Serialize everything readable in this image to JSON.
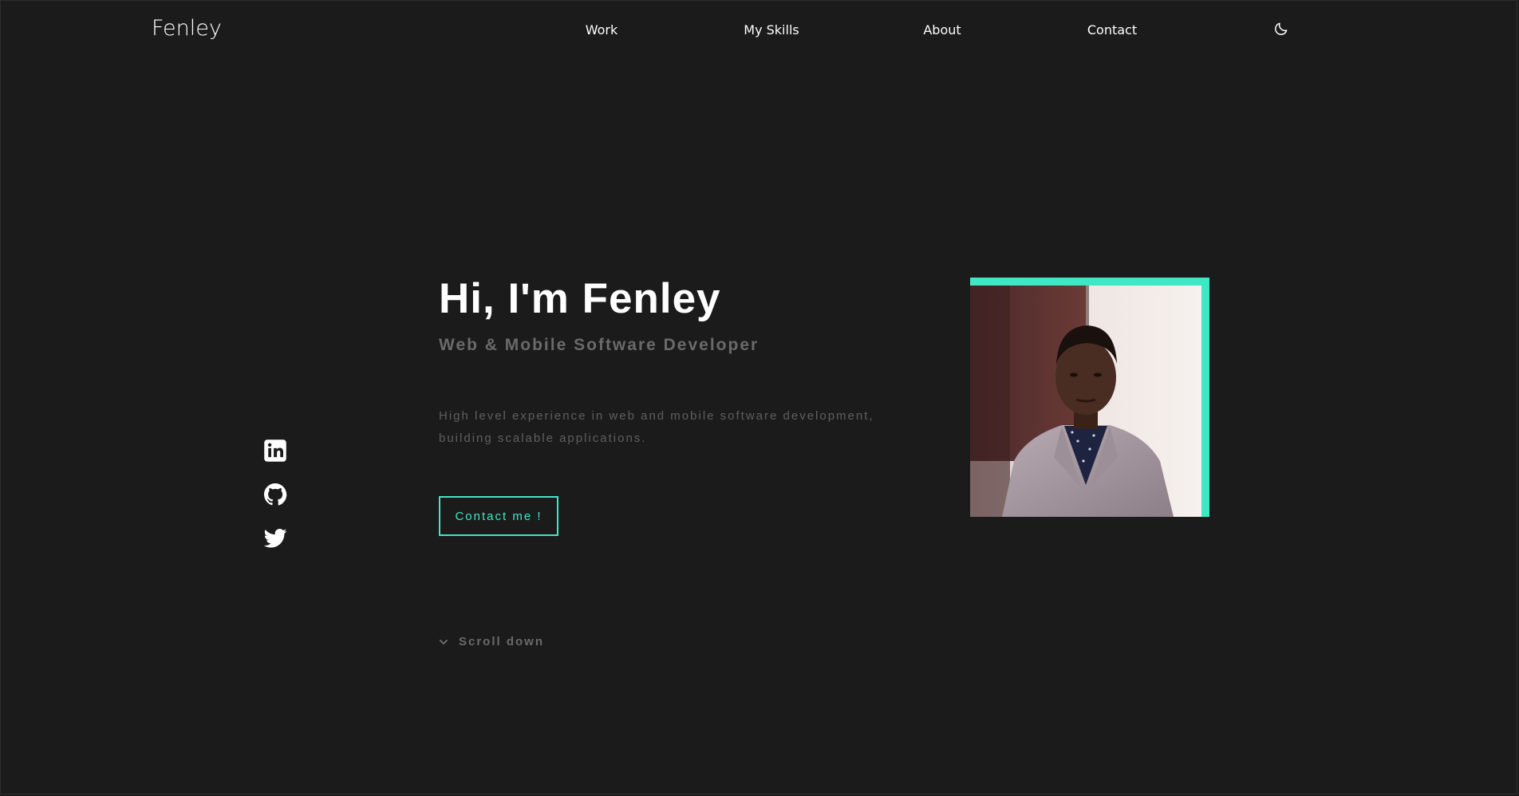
{
  "header": {
    "logo": "Fenley",
    "nav": [
      {
        "label": "Work"
      },
      {
        "label": "My Skills"
      },
      {
        "label": "About"
      },
      {
        "label": "Contact"
      }
    ],
    "theme_toggle_icon": "moon-icon"
  },
  "social": [
    {
      "icon": "linkedin-icon"
    },
    {
      "icon": "github-icon"
    },
    {
      "icon": "twitter-icon"
    }
  ],
  "hero": {
    "title": "Hi, I'm Fenley",
    "subtitle": "Web & Mobile Software Developer",
    "description": "High level experience in web and mobile software development, building scalable applications.",
    "cta_label": "Contact me !",
    "scroll_label": "Scroll down",
    "scroll_icon": "chevron-down-icon",
    "portrait_icon": "profile-photo"
  },
  "colors": {
    "background": "#1b1b1b",
    "accent": "#3de8c4",
    "text": "#ffffff",
    "muted": "#6a6a6a"
  }
}
